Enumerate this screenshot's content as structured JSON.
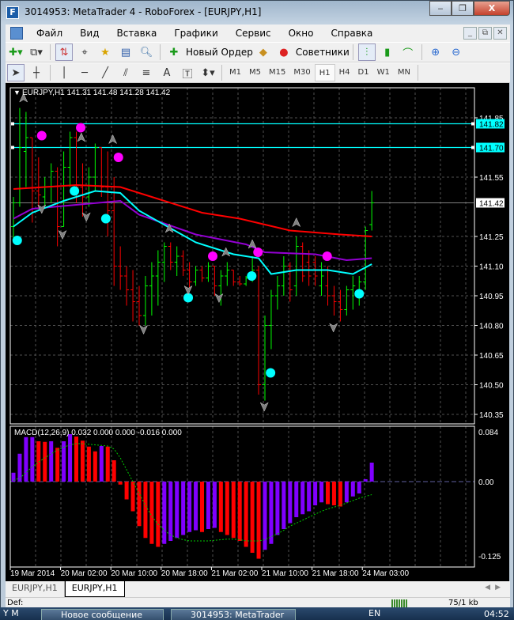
{
  "window": {
    "title": "3014953: MetaTrader 4 - RoboForex - [EURJPY,H1]",
    "minimize": "‒",
    "restore": "❐",
    "close": "X"
  },
  "menu": [
    "Файл",
    "Вид",
    "Вставка",
    "Графики",
    "Сервис",
    "Окно",
    "Справка"
  ],
  "mdi": {
    "minimize": "_",
    "restore": "⧉",
    "close": "✕"
  },
  "toolbar": {
    "new_order": "Новый Ордер",
    "advisors": "Советники"
  },
  "timeframes": [
    "M1",
    "M5",
    "M15",
    "M30",
    "H1",
    "H4",
    "D1",
    "W1",
    "MN"
  ],
  "active_timeframe": "H1",
  "chart": {
    "header": "EURJPY,H1  141.31 141.48 141.28 141.42",
    "price_ticks": [
      "141.85",
      "141.55",
      "141.25",
      "141.10",
      "140.95",
      "140.80",
      "140.65",
      "140.50",
      "140.35"
    ],
    "price_tick_values": [
      141.85,
      141.55,
      141.25,
      141.1,
      140.95,
      140.8,
      140.65,
      140.5,
      140.35
    ],
    "hlines": [
      {
        "value": 141.82,
        "label": "141.82"
      },
      {
        "value": 141.7,
        "label": "141.70"
      }
    ],
    "current_price": {
      "value": 141.42,
      "label": "141.42"
    },
    "colors": {
      "bull": "#00ff00",
      "bear": "#ff0000",
      "ma_slow": "#ff0000",
      "ma_mid": "#9400d3",
      "ma_fast": "#00ffff",
      "hline": "#00ffff",
      "sell_dot": "#ff00ff",
      "buy_dot": "#00ffff",
      "arrow": "#808080",
      "grid": "#505050"
    },
    "ohlc": [
      [
        141.3,
        141.45,
        141.22,
        141.42
      ],
      [
        141.42,
        141.9,
        141.4,
        141.7
      ],
      [
        141.68,
        141.88,
        141.5,
        141.75
      ],
      [
        141.75,
        141.75,
        141.32,
        141.48
      ],
      [
        141.48,
        141.65,
        141.38,
        141.46
      ],
      [
        141.45,
        141.55,
        141.4,
        141.5
      ],
      [
        141.5,
        141.62,
        141.42,
        141.58
      ],
      [
        141.58,
        141.6,
        141.2,
        141.3
      ],
      [
        141.3,
        141.68,
        141.3,
        141.6
      ],
      [
        141.6,
        141.78,
        141.5,
        141.75
      ],
      [
        141.75,
        141.78,
        141.42,
        141.5
      ],
      [
        141.5,
        141.62,
        141.35,
        141.45
      ],
      [
        141.45,
        141.6,
        141.4,
        141.55
      ],
      [
        141.55,
        141.72,
        141.48,
        141.7
      ],
      [
        141.7,
        141.7,
        141.45,
        141.5
      ],
      [
        141.5,
        141.68,
        141.25,
        141.38
      ],
      [
        141.38,
        141.55,
        141.0,
        141.1
      ],
      [
        141.1,
        141.2,
        140.98,
        141.05
      ],
      [
        141.05,
        141.1,
        140.9,
        140.98
      ],
      [
        140.98,
        141.08,
        140.82,
        140.92
      ],
      [
        140.92,
        141.0,
        140.8,
        140.85
      ],
      [
        140.85,
        141.05,
        140.8,
        141.0
      ],
      [
        141.0,
        141.12,
        140.85,
        141.05
      ],
      [
        141.05,
        141.18,
        140.9,
        141.12
      ],
      [
        141.12,
        141.22,
        141.02,
        141.2
      ],
      [
        141.2,
        141.22,
        141.08,
        141.12
      ],
      [
        141.12,
        141.2,
        141.05,
        141.15
      ],
      [
        141.15,
        141.18,
        141.05,
        141.08
      ],
      [
        141.08,
        141.12,
        140.98,
        141.02
      ],
      [
        141.02,
        141.1,
        141.0,
        141.08
      ],
      [
        141.08,
        141.1,
        141.02,
        141.04
      ],
      [
        141.04,
        141.12,
        141.02,
        141.1
      ],
      [
        141.1,
        141.1,
        140.95,
        141.0
      ],
      [
        141.0,
        141.08,
        140.9,
        141.05
      ],
      [
        141.05,
        141.12,
        141.0,
        141.08
      ],
      [
        141.08,
        141.08,
        141.0,
        141.02
      ],
      [
        141.02,
        141.05,
        141.0,
        141.01
      ],
      [
        141.01,
        141.05,
        141.0,
        141.04
      ],
      [
        141.04,
        141.15,
        141.02,
        141.08
      ],
      [
        141.08,
        141.1,
        140.45,
        140.5
      ],
      [
        140.5,
        140.85,
        140.42,
        140.8
      ],
      [
        140.8,
        140.98,
        140.68,
        140.95
      ],
      [
        140.95,
        141.05,
        140.88,
        141.0
      ],
      [
        141.0,
        141.15,
        140.95,
        141.1
      ],
      [
        141.1,
        141.12,
        140.92,
        140.98
      ],
      [
        141.0,
        141.25,
        140.95,
        141.2
      ],
      [
        141.2,
        141.22,
        141.02,
        141.05
      ],
      [
        141.12,
        141.18,
        141.0,
        141.05
      ],
      [
        141.12,
        141.15,
        141.0,
        141.05
      ],
      [
        141.0,
        141.12,
        140.95,
        141.05
      ],
      [
        141.0,
        141.1,
        140.9,
        140.95
      ],
      [
        140.95,
        141.0,
        140.85,
        140.92
      ],
      [
        140.92,
        140.98,
        140.82,
        140.88
      ],
      [
        140.88,
        141.0,
        140.85,
        140.98
      ],
      [
        140.98,
        141.05,
        140.88,
        141.0
      ],
      [
        140.95,
        141.05,
        140.9,
        141.02
      ],
      [
        141.02,
        141.3,
        140.98,
        141.28
      ],
      [
        141.31,
        141.48,
        141.28,
        141.42
      ]
    ],
    "ma_slow": [
      [
        0,
        141.49
      ],
      [
        5,
        141.5
      ],
      [
        10,
        141.51
      ],
      [
        17,
        141.5
      ],
      [
        23,
        141.44
      ],
      [
        30,
        141.37
      ],
      [
        36,
        141.34
      ],
      [
        40,
        141.31
      ],
      [
        44,
        141.28
      ],
      [
        52,
        141.26
      ],
      [
        57,
        141.25
      ]
    ],
    "ma_mid": [
      [
        0,
        141.34
      ],
      [
        3,
        141.39
      ],
      [
        10,
        141.41
      ],
      [
        17,
        141.43
      ],
      [
        20,
        141.36
      ],
      [
        29,
        141.26
      ],
      [
        37,
        141.21
      ],
      [
        40,
        141.17
      ],
      [
        48,
        141.16
      ],
      [
        53,
        141.13
      ],
      [
        57,
        141.14
      ]
    ],
    "ma_fast": [
      [
        0,
        141.3
      ],
      [
        3,
        141.37
      ],
      [
        8,
        141.43
      ],
      [
        13,
        141.48
      ],
      [
        17,
        141.47
      ],
      [
        20,
        141.38
      ],
      [
        29,
        141.22
      ],
      [
        35,
        141.16
      ],
      [
        39,
        141.14
      ],
      [
        41,
        141.06
      ],
      [
        45,
        141.08
      ],
      [
        50,
        141.08
      ],
      [
        54,
        141.06
      ],
      [
        57,
        141.11
      ]
    ],
    "sell_dots": [
      [
        4.5,
        141.76
      ],
      [
        10.7,
        141.8
      ],
      [
        16.7,
        141.65
      ],
      [
        31.7,
        141.15
      ],
      [
        38.9,
        141.17
      ],
      [
        49.9,
        141.15
      ]
    ],
    "buy_dots": [
      [
        0.6,
        141.23
      ],
      [
        9.7,
        141.48
      ],
      [
        14.7,
        141.34
      ],
      [
        27.8,
        140.94
      ],
      [
        37.9,
        141.05
      ],
      [
        40.9,
        140.56
      ],
      [
        55,
        140.96
      ]
    ],
    "up_arrows": [
      [
        1.6,
        141.95
      ],
      [
        10.8,
        141.75
      ],
      [
        15.8,
        141.74
      ],
      [
        24.8,
        141.29
      ],
      [
        33.8,
        141.17
      ],
      [
        38,
        141.21
      ],
      [
        45,
        141.32
      ]
    ],
    "down_arrows": [
      [
        4.5,
        141.39
      ],
      [
        7.8,
        141.26
      ],
      [
        11.6,
        141.35
      ],
      [
        20.7,
        140.78
      ],
      [
        27.8,
        140.98
      ],
      [
        32.7,
        140.94
      ],
      [
        39.9,
        140.39
      ],
      [
        50.9,
        140.79
      ]
    ]
  },
  "macd": {
    "header": "MACD(12,26,9) 0.032 0.000 0.000 -0.016 0.000",
    "ticks": [
      {
        "value": 0.084,
        "label": "0.084"
      },
      {
        "value": 0,
        "label": "0.00"
      },
      {
        "value": -0.125,
        "label": "-0.125"
      }
    ],
    "colors": {
      "up": "#8000ff",
      "down": "#ff0000",
      "signal": "#00c800"
    },
    "histogram": [
      0.015,
      0.047,
      0.075,
      0.075,
      0.068,
      0.067,
      0.068,
      0.057,
      0.068,
      0.08,
      0.076,
      0.069,
      0.059,
      0.051,
      0.06,
      0.059,
      0.036,
      -0.005,
      -0.03,
      -0.05,
      -0.075,
      -0.095,
      -0.105,
      -0.11,
      -0.105,
      -0.1,
      -0.095,
      -0.09,
      -0.085,
      -0.082,
      -0.085,
      -0.08,
      -0.078,
      -0.085,
      -0.09,
      -0.095,
      -0.1,
      -0.11,
      -0.12,
      -0.13,
      -0.115,
      -0.105,
      -0.09,
      -0.08,
      -0.07,
      -0.06,
      -0.055,
      -0.05,
      -0.04,
      -0.035,
      -0.038,
      -0.04,
      -0.042,
      -0.035,
      -0.025,
      -0.02,
      0.004,
      0.032
    ],
    "signal": [
      0.002,
      0.006,
      0.015,
      0.025,
      0.033,
      0.04,
      0.047,
      0.053,
      0.058,
      0.062,
      0.064,
      0.064,
      0.063,
      0.062,
      0.061,
      0.06,
      0.055,
      0.04,
      0.02,
      0.0,
      -0.02,
      -0.04,
      -0.058,
      -0.072,
      -0.082,
      -0.09,
      -0.095,
      -0.098,
      -0.1,
      -0.1,
      -0.1,
      -0.1,
      -0.099,
      -0.098,
      -0.097,
      -0.097,
      -0.098,
      -0.1,
      -0.1,
      -0.1,
      -0.098,
      -0.093,
      -0.088,
      -0.082,
      -0.075,
      -0.07,
      -0.065,
      -0.06,
      -0.055,
      -0.05,
      -0.046,
      -0.043,
      -0.04,
      -0.036,
      -0.032,
      -0.028,
      -0.025,
      -0.022
    ]
  },
  "time_labels": [
    {
      "bar": 0,
      "label": "19 Mar 2014"
    },
    {
      "bar": 8,
      "label": "20 Mar 02:00"
    },
    {
      "bar": 16,
      "label": "20 Mar 10:00"
    },
    {
      "bar": 24,
      "label": "20 Mar 18:00"
    },
    {
      "bar": 32,
      "label": "21 Mar 02:00"
    },
    {
      "bar": 40,
      "label": "21 Mar 10:00"
    },
    {
      "bar": 48,
      "label": "21 Mar 18:00"
    },
    {
      "bar": 56,
      "label": "24 Mar 03:00"
    }
  ],
  "tabs": [
    "EURJPY,H1",
    "EURJPY,H1"
  ],
  "status": {
    "profile": "Def:",
    "traffic": "75/1 kb"
  },
  "taskbar": {
    "left_task": "Y  M",
    "chrome_task": "Новое сообщение",
    "mt4_task": "3014953: MetaTrader",
    "lang": "EN",
    "time": "04:52"
  }
}
